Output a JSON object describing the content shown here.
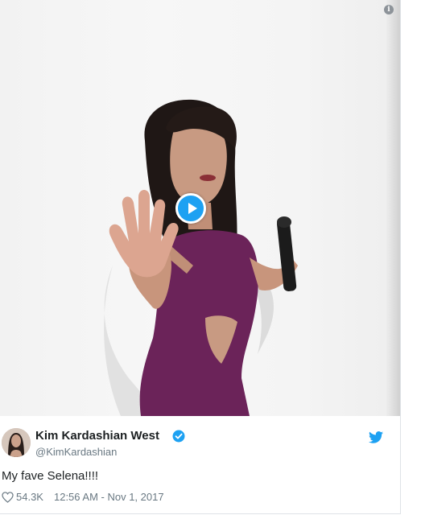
{
  "tweet": {
    "display_name": "Kim Kardashian West",
    "handle": "@KimKardashian",
    "text": "My fave Selena!!!!",
    "likes": "54.3K",
    "timestamp": "12:56 AM - Nov 1, 2017",
    "verified": true
  },
  "media": {
    "type": "video",
    "play_icon": "play-icon",
    "info_icon": "info-icon"
  },
  "icons": {
    "brand": "twitter-bird-icon",
    "verified": "verified-badge-icon",
    "like": "heart-icon"
  },
  "colors": {
    "accent": "#1da1f2",
    "text_primary": "#1c2022",
    "text_secondary": "#697882",
    "dress": "#6b2359"
  }
}
